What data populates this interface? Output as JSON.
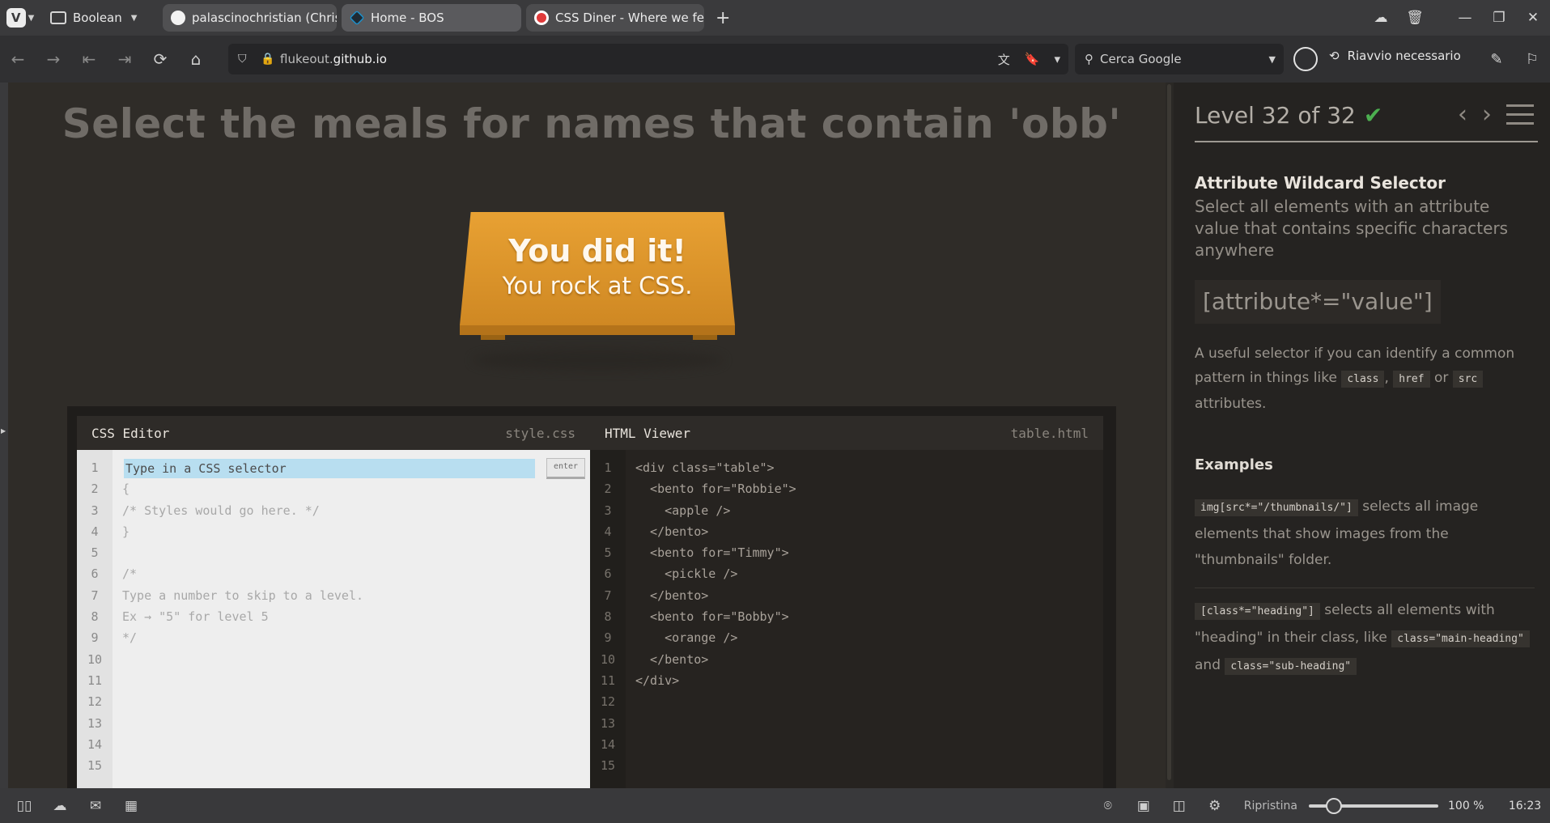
{
  "browser": {
    "workspace": "Boolean",
    "tabs": [
      {
        "title": "palascinochristian (Christian"
      },
      {
        "title": "Home - BOS"
      },
      {
        "title": "CSS Diner - Where we feast"
      }
    ],
    "url": {
      "prefix": "flukeout.",
      "domain": "github.io"
    },
    "search_placeholder": "Cerca Google",
    "update_label": "Riavvio necessario"
  },
  "game": {
    "instruction": "Select the meals for names that contain 'obb'",
    "success": {
      "title": "You did it!",
      "subtitle": "You rock at CSS."
    },
    "css_editor": {
      "title": "CSS Editor",
      "file": "style.css",
      "input_placeholder": "Type in a CSS selector",
      "enter_label": "enter",
      "lines": [
        "",
        "{",
        "/* Styles would go here. */",
        "}",
        "",
        "/*",
        "Type a number to skip to a level.",
        "Ex → \"5\" for level 5",
        "*/",
        "",
        "",
        "",
        "",
        "",
        ""
      ]
    },
    "html_viewer": {
      "title": "HTML Viewer",
      "file": "table.html",
      "lines": [
        "<div class=\"table\">",
        "  <bento for=\"Robbie\">",
        "    <apple />",
        "  </bento>",
        "  <bento for=\"Timmy\">",
        "    <pickle />",
        "  </bento>",
        "  <bento for=\"Bobby\">",
        "    <orange />",
        "  </bento>",
        "</div>",
        "",
        "",
        "",
        ""
      ]
    },
    "line_numbers": [
      "1",
      "2",
      "3",
      "4",
      "5",
      "6",
      "7",
      "8",
      "9",
      "10",
      "11",
      "12",
      "13",
      "14",
      "15"
    ]
  },
  "level": {
    "label": "Level 32 of 32",
    "progress_fraction": 1.0,
    "title": "Attribute Wildcard Selector",
    "description": "Select all elements with an attribute value that contains specific characters anywhere",
    "syntax": "[attribute*=\"value\"]",
    "help_pre": "A useful selector if you can identify a common pattern in things like",
    "help_codes": [
      "class",
      "href",
      "src"
    ],
    "help_sep": ",",
    "help_or": "or",
    "help_post": "attributes.",
    "examples_heading": "Examples",
    "example1": {
      "code": "img[src*=\"/thumbnails/\"]",
      "text": "selects all image elements that show images from the \"thumbnails\" folder."
    },
    "example2": {
      "code": "[class*=\"heading\"]",
      "text1": "selects all elements with \"heading\" in their class, like",
      "code2": "class=\"main-heading\"",
      "and": "and",
      "code3": "class=\"sub-heading\""
    }
  },
  "statusbar": {
    "reset_label": "Ripristina",
    "zoom": "100 %",
    "zoom_slider_fraction": 0.15,
    "time": "16:23"
  }
}
